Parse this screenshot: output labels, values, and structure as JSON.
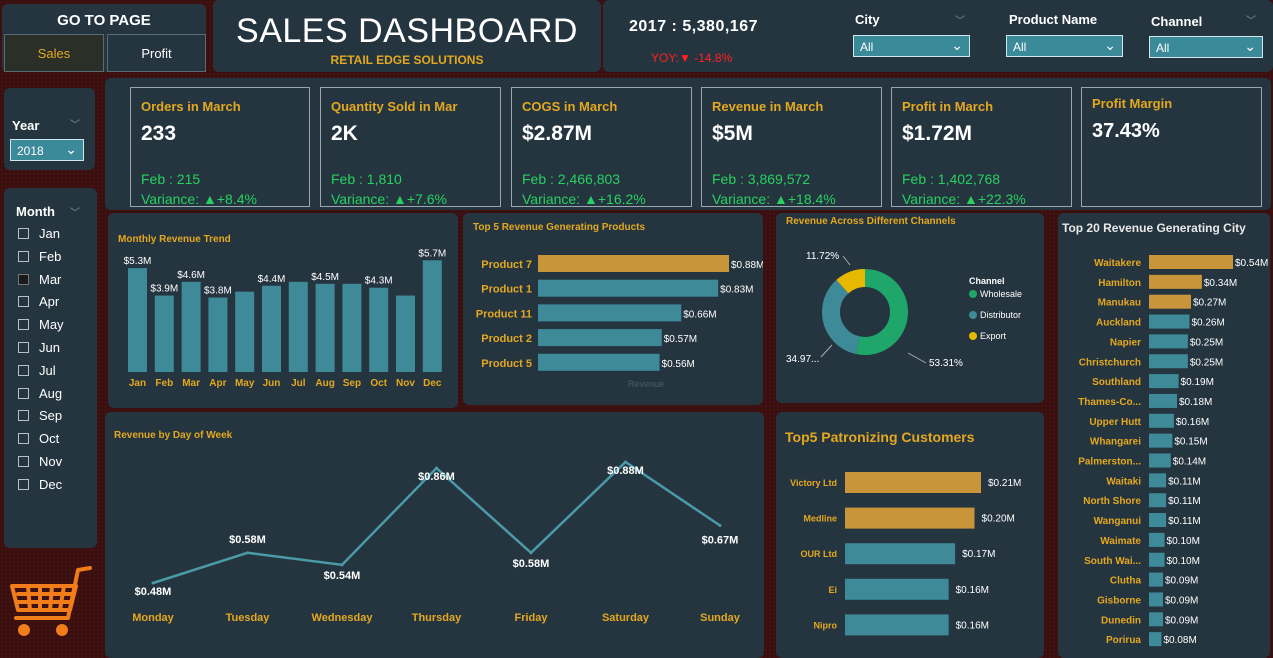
{
  "nav": {
    "title": "GO TO PAGE",
    "sales_label": "Sales",
    "profit_label": "Profit"
  },
  "header": {
    "title": "SALES DASHBOARD",
    "subtitle": "RETAIL EDGE SOLUTIONS",
    "year_total": "2017 : 5,380,167",
    "yoy": "YOY:▼ -14.8%"
  },
  "filters": {
    "city": {
      "label": "City",
      "value": "All"
    },
    "product": {
      "label": "Product Name",
      "value": "All"
    },
    "channel": {
      "label": "Channel",
      "value": "All"
    },
    "year": {
      "label": "Year",
      "value": "2018"
    }
  },
  "months": {
    "label": "Month",
    "items": [
      "Jan",
      "Feb",
      "Mar",
      "Apr",
      "May",
      "Jun",
      "Jul",
      "Aug",
      "Sep",
      "Oct",
      "Nov",
      "Dec"
    ],
    "selected": "Mar"
  },
  "kpis": [
    {
      "title": "Orders in March",
      "value": "233",
      "prev": "Feb : 215",
      "variance": "Variance: ▲+8.4%"
    },
    {
      "title": "Quantity Sold in Mar",
      "value": "2K",
      "prev": "Feb : 1,810",
      "variance": "Variance: ▲+7.6%"
    },
    {
      "title": "COGS in March",
      "value": "$2.87M",
      "prev": "Feb : 2,466,803",
      "variance": "Variance: ▲+16.2%"
    },
    {
      "title": "Revenue in March",
      "value": "$5M",
      "prev": "Feb : 3,869,572",
      "variance": "Variance: ▲+18.4%"
    },
    {
      "title": "Profit in March",
      "value": "$1.72M",
      "prev": "Feb : 1,402,768",
      "variance": "Variance: ▲+22.3%"
    },
    {
      "title": "Profit Margin",
      "value": "37.43%"
    }
  ],
  "colors": {
    "teal": "#3e8a99",
    "gold": "#c9953a",
    "green": "#1fa66a",
    "yellow": "#e6b800",
    "line": "#4a9aa8"
  },
  "chart_data": [
    {
      "type": "bar",
      "title": "Monthly Revenue Trend",
      "categories": [
        "Jan",
        "Feb",
        "Mar",
        "Apr",
        "May",
        "Jun",
        "Jul",
        "Aug",
        "Sep",
        "Oct",
        "Nov",
        "Dec"
      ],
      "values": [
        5.3,
        3.9,
        4.6,
        3.8,
        4.1,
        4.4,
        4.6,
        4.5,
        4.5,
        4.3,
        3.9,
        5.7
      ],
      "labels": [
        "$5.3M",
        "$3.9M",
        "$4.6M",
        "$3.8M",
        "",
        "$4.4M",
        "",
        "$4.5M",
        "",
        "$4.3M",
        "",
        "$5.7M"
      ],
      "ylim": [
        0,
        6
      ]
    },
    {
      "type": "bar",
      "title": "Top 5 Revenue Generating Products",
      "xlabel": "Revenue",
      "categories": [
        "Product 7",
        "Product 1",
        "Product 11",
        "Product 2",
        "Product 5"
      ],
      "values": [
        0.88,
        0.83,
        0.66,
        0.57,
        0.56
      ],
      "labels": [
        "$0.88M",
        "$0.83M",
        "$0.66M",
        "$0.57M",
        "$0.56M"
      ],
      "highlight": [
        true,
        false,
        false,
        false,
        false
      ]
    },
    {
      "type": "pie",
      "title": "Revenue Across Different Channels",
      "legend_title": "Channel",
      "categories": [
        "Wholesale",
        "Distributor",
        "Export"
      ],
      "values": [
        53.31,
        34.97,
        11.72
      ],
      "labels": [
        "53.31%",
        "34.97...",
        "11.72%"
      ]
    },
    {
      "type": "line",
      "title": "Revenue by Day of Week",
      "categories": [
        "Monday",
        "Tuesday",
        "Wednesday",
        "Thursday",
        "Friday",
        "Saturday",
        "Sunday"
      ],
      "values": [
        0.48,
        0.58,
        0.54,
        0.86,
        0.58,
        0.88,
        0.67
      ],
      "labels": [
        "$0.48M",
        "$0.58M",
        "$0.54M",
        "$0.86M",
        "$0.58M",
        "$0.88M",
        "$0.67M"
      ]
    },
    {
      "type": "bar",
      "title": "Top5 Patronizing Customers",
      "categories": [
        "Victory Ltd",
        "Medline",
        "OUR Ltd",
        "Ei",
        "Nipro"
      ],
      "values": [
        0.21,
        0.2,
        0.17,
        0.16,
        0.16
      ],
      "labels": [
        "$0.21M",
        "$0.20M",
        "$0.17M",
        "$0.16M",
        "$0.16M"
      ],
      "highlight": [
        true,
        true,
        false,
        false,
        false
      ]
    },
    {
      "type": "bar",
      "title": "Top 20 Revenue Generating City",
      "categories": [
        "Waitakere",
        "Hamilton",
        "Manukau",
        "Auckland",
        "Napier",
        "Christchurch",
        "Southland",
        "Thames-Co...",
        "Upper Hutt",
        "Whangarei",
        "Palmerston...",
        "Waitaki",
        "North Shore",
        "Wanganui",
        "Waimate",
        "South Wai...",
        "Clutha",
        "Gisborne",
        "Dunedin",
        "Porirua"
      ],
      "values": [
        0.54,
        0.34,
        0.27,
        0.26,
        0.25,
        0.25,
        0.19,
        0.18,
        0.16,
        0.15,
        0.14,
        0.11,
        0.11,
        0.11,
        0.1,
        0.1,
        0.09,
        0.09,
        0.09,
        0.08
      ],
      "labels": [
        "$0.54M",
        "$0.34M",
        "$0.27M",
        "$0.26M",
        "$0.25M",
        "$0.25M",
        "$0.19M",
        "$0.18M",
        "$0.16M",
        "$0.15M",
        "$0.14M",
        "$0.11M",
        "$0.11M",
        "$0.11M",
        "$0.10M",
        "$0.10M",
        "$0.09M",
        "$0.09M",
        "$0.09M",
        "$0.08M"
      ],
      "highlight": [
        true,
        true,
        true,
        false,
        false,
        false,
        false,
        false,
        false,
        false,
        false,
        false,
        false,
        false,
        false,
        false,
        false,
        false,
        false,
        false
      ]
    }
  ]
}
